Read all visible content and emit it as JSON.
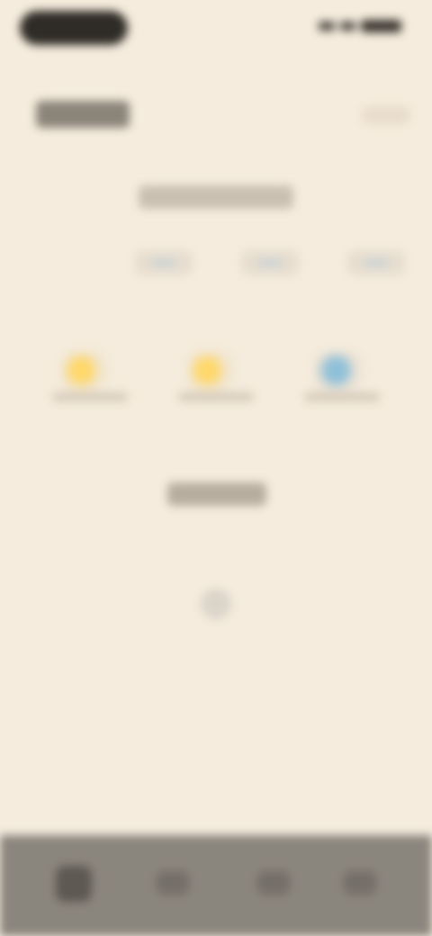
{
  "status_bar": {
    "time": "",
    "signal": "",
    "battery": ""
  },
  "header": {
    "title": "",
    "action": ""
  },
  "summary": {
    "title": "",
    "tabs": [
      "",
      "",
      ""
    ]
  },
  "stats": [
    {
      "label": "",
      "icon": "sun-icon",
      "color": "#ffd86a"
    },
    {
      "label": "",
      "icon": "sun-icon",
      "color": "#ffd86a"
    },
    {
      "label": "",
      "icon": "cloud-icon",
      "color": "#8fc0d8"
    }
  ],
  "calendar": {
    "title": "",
    "weekday_labels": [
      "",
      "",
      "",
      "",
      "",
      "",
      ""
    ],
    "days": [
      "",
      "",
      "",
      "",
      "",
      "",
      "",
      "",
      "",
      "",
      "",
      "",
      "",
      "",
      "",
      "",
      "",
      "",
      "",
      "",
      "",
      "",
      "",
      "",
      "",
      "",
      "",
      "",
      "",
      "",
      ""
    ],
    "today_index": 3
  },
  "bottom_nav": [
    {
      "label": "",
      "icon": "home-icon"
    },
    {
      "label": "",
      "icon": "list-icon"
    },
    {
      "label": "",
      "icon": "chart-icon"
    },
    {
      "label": "",
      "icon": "settings-icon"
    }
  ]
}
